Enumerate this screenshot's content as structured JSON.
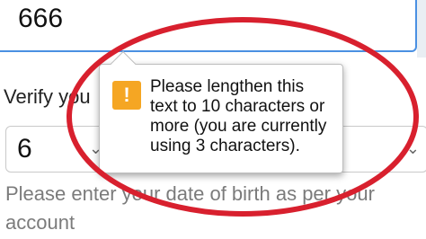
{
  "top_field": {
    "value": "666"
  },
  "verify_label": "Verify you",
  "select_field": {
    "value": "6"
  },
  "help_text": "Please enter your date of birth as per your account",
  "tooltip": {
    "icon": "!",
    "message": "Please lengthen this text to 10 characters or more (you are currently using 3 characters)."
  },
  "colors": {
    "focus_border": "#4a90e2",
    "warning": "#f5a623",
    "annotation_ring": "#d8202e",
    "help_text": "#7b7b7b"
  },
  "icons": [
    "warning-icon",
    "chevron-down-icon"
  ]
}
